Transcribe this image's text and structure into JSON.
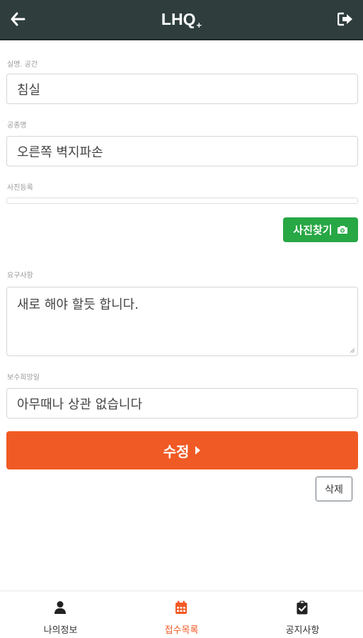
{
  "header": {
    "title": "LHQ",
    "title_suffix": "+"
  },
  "form": {
    "space_label": "실명. 공간",
    "space_value": "침실",
    "work_label": "공종명",
    "work_value": "오른쪽 벽지파손",
    "photo_label": "사진등록",
    "find_photo_label": "사진찾기",
    "request_label": "요구사항",
    "request_value": "새로 해야 할듯 합니다.",
    "repair_date_label": "보수희망일",
    "repair_date_value": "아무때나 상관 없습니다",
    "submit_label": "수정",
    "delete_label": "삭제"
  },
  "bottom_nav": {
    "items": [
      {
        "label": "나의정보",
        "icon": "user-icon",
        "active": false
      },
      {
        "label": "접수목록",
        "icon": "calendar-icon",
        "active": true
      },
      {
        "label": "공지사항",
        "icon": "clipboard-check-icon",
        "active": false
      }
    ]
  },
  "colors": {
    "header_bg": "#2f3d3d",
    "accent": "#f05a24",
    "find_photo_bg": "#28a745"
  }
}
